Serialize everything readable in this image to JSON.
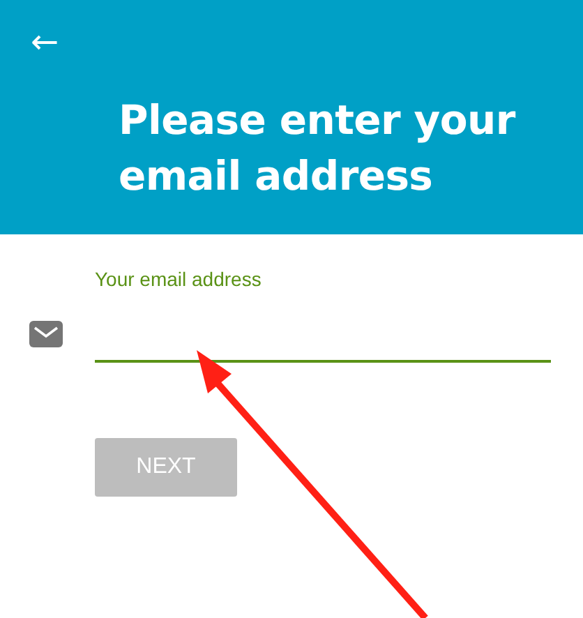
{
  "header": {
    "back": "←",
    "title": "Please enter your email address"
  },
  "email_field": {
    "label": "Your email address",
    "focused": true
  },
  "next_button": {
    "label": "NEXT",
    "disabled": true
  }
}
